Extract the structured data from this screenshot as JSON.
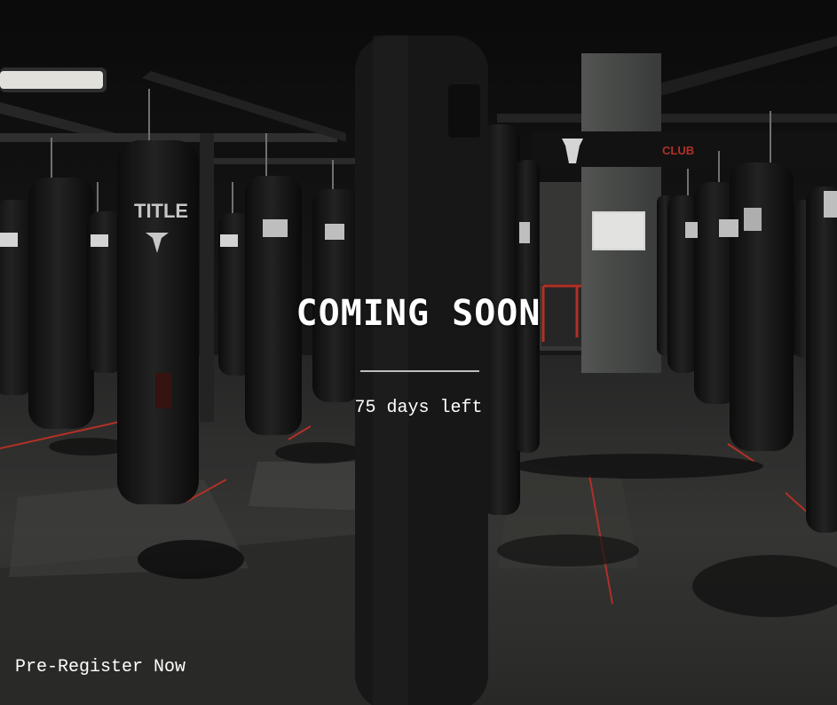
{
  "headline": "COMING SOON",
  "countdown": "75 days left",
  "cta_label": "Pre-Register Now",
  "bag_brand": "TITLE",
  "sign_text": "CLUB",
  "colors": {
    "text": "#ffffff",
    "divider": "#bdbdbd",
    "floor_tape": "#c0352a",
    "bag": "#1a1a1a"
  }
}
